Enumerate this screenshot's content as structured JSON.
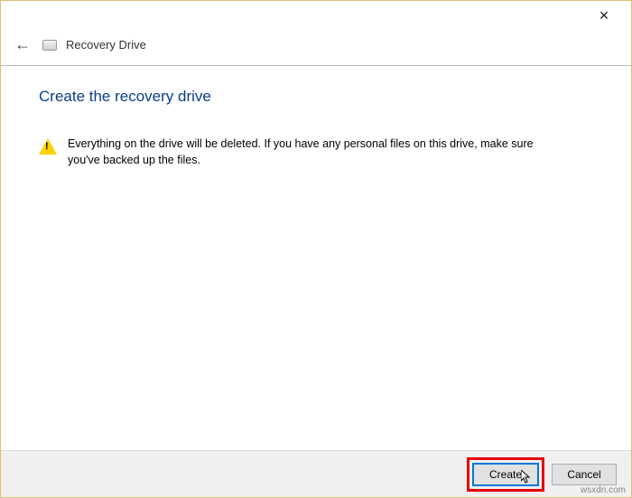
{
  "titlebar": {
    "close_symbol": "✕"
  },
  "header": {
    "back_symbol": "←",
    "app_title": "Recovery Drive"
  },
  "main": {
    "heading": "Create the recovery drive",
    "warning_text": "Everything on the drive will be deleted. If you have any personal files on this drive, make sure you've backed up the files."
  },
  "footer": {
    "primary_label": "Create",
    "cancel_label": "Cancel"
  },
  "watermark": "wsxdn.com"
}
